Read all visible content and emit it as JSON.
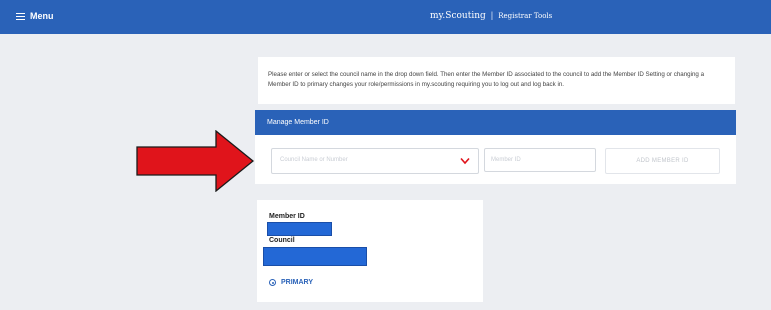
{
  "header": {
    "menu_label": "Menu",
    "brand_name": "my.Scouting",
    "brand_separator": "|",
    "app_name": "Registrar Tools",
    "color": "#2a62b8"
  },
  "intro": {
    "text": "Please enter or select the council name in the drop down field. Then enter the Member ID associated to the council to add the Member ID Setting or changing a Member ID to primary changes your role/permissions in my.scouting requiring you to log out and log back in."
  },
  "manage": {
    "title": "Manage Member ID",
    "council_placeholder": "Council Name or Number",
    "member_id_placeholder": "Member ID",
    "add_button_label": "ADD MEMBER ID"
  },
  "member_card": {
    "member_id_label": "Member ID",
    "council_label": "Council",
    "primary_label": "PRIMARY",
    "primary_selected": true
  },
  "annotation": {
    "arrow_color": "#e0141b",
    "redaction_color": "#2368d6"
  }
}
